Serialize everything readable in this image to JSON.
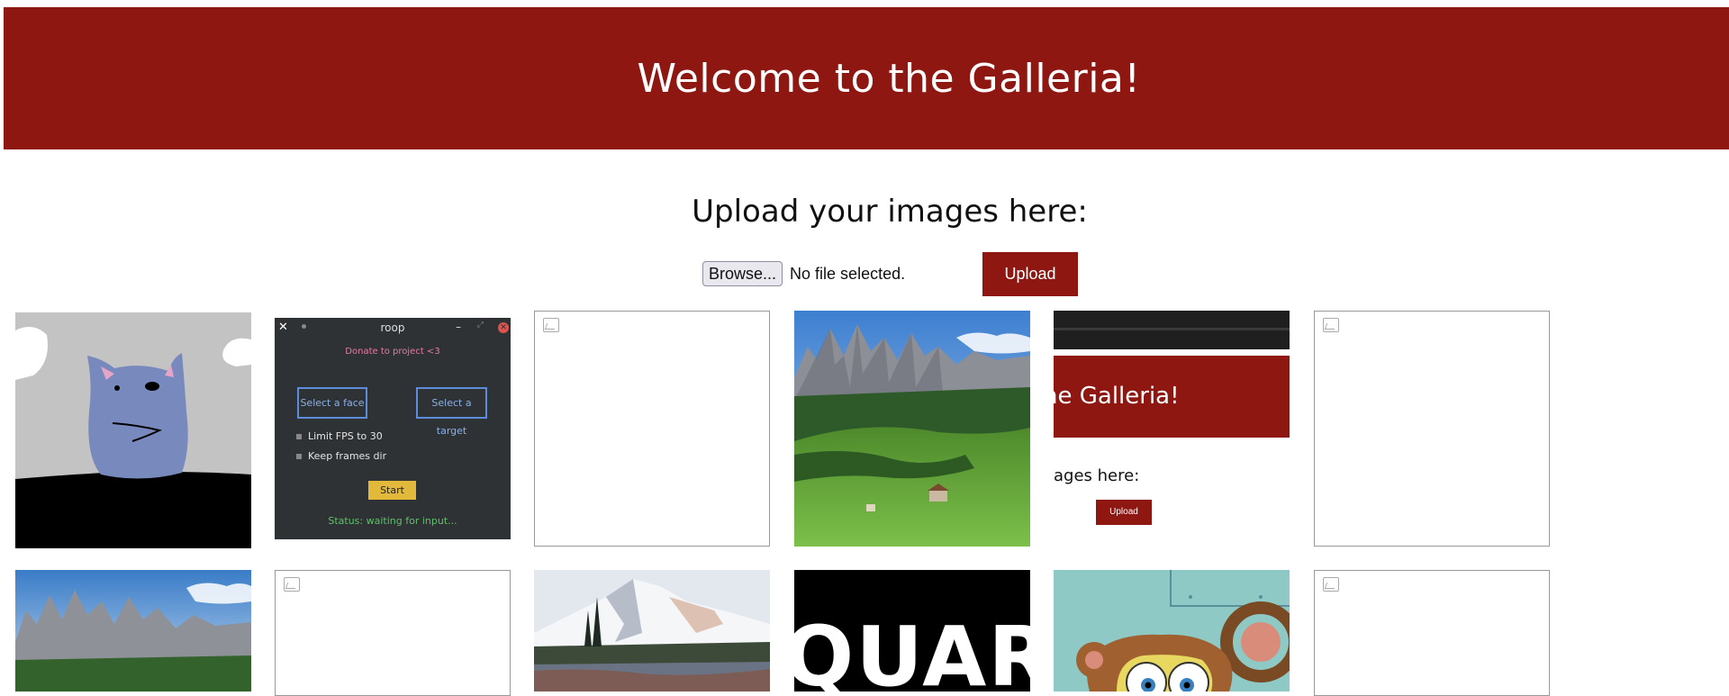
{
  "header": {
    "title": "Welcome to the Galleria!"
  },
  "upload": {
    "heading": "Upload your images here:",
    "browse_label": "Browse...",
    "file_status": "No file selected.",
    "upload_label": "Upload"
  },
  "colors": {
    "brand": "#8e1712"
  },
  "gallery": {
    "roop": {
      "title": "roop",
      "donate": "Donate to project <3",
      "select_face": "Select a face",
      "select_target": "Select a target",
      "limit_fps": "Limit FPS to 30",
      "keep_frames": "Keep frames dir",
      "start": "Start",
      "status": "Status: waiting for input..."
    },
    "galleria_shot": {
      "title_fragment": "he Galleria!",
      "heading_fragment": "ages here:",
      "upload": "Upload"
    },
    "quar_text": "QUAR"
  }
}
